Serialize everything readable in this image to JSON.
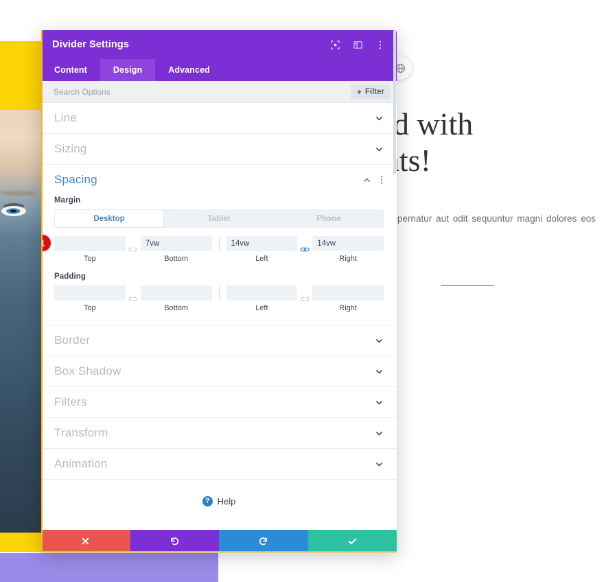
{
  "background": {
    "heading_line1": "worked with",
    "heading_line2": "g clients!",
    "paragraph": "tatem quia voluptas sit aspernatur aut odit sequuntur magni dolores eos qui ratione nt.",
    "globe_icon": "globe-icon"
  },
  "modal": {
    "title": "Divider Settings",
    "header_icons": [
      {
        "name": "focus-icon",
        "glyph": "⬚"
      },
      {
        "name": "panel-layout-icon",
        "glyph": "▣"
      },
      {
        "name": "more-options-icon",
        "glyph": "⋮"
      }
    ],
    "tabs": [
      {
        "label": "Content",
        "active": false
      },
      {
        "label": "Design",
        "active": true
      },
      {
        "label": "Advanced",
        "active": false
      }
    ],
    "search": {
      "placeholder": "Search Options",
      "value": ""
    },
    "filter": {
      "label": "Filter",
      "plus": "+"
    },
    "sections": [
      {
        "id": "line",
        "label": "Line",
        "open": false
      },
      {
        "id": "sizing",
        "label": "Sizing",
        "open": false
      },
      {
        "id": "spacing",
        "label": "Spacing",
        "open": true
      },
      {
        "id": "border",
        "label": "Border",
        "open": false
      },
      {
        "id": "box-shadow",
        "label": "Box Shadow",
        "open": false
      },
      {
        "id": "filters",
        "label": "Filters",
        "open": false
      },
      {
        "id": "transform",
        "label": "Transform",
        "open": false
      },
      {
        "id": "animation",
        "label": "Animation",
        "open": false
      }
    ],
    "spacing": {
      "badge": "1",
      "margin_label": "Margin",
      "padding_label": "Padding",
      "device_tabs": [
        {
          "label": "Desktop",
          "active": true
        },
        {
          "label": "Tablet",
          "active": false
        },
        {
          "label": "Phone",
          "active": false
        }
      ],
      "margin": {
        "top": {
          "caption": "Top",
          "value": ""
        },
        "bottom": {
          "caption": "Bottom",
          "value": "7vw"
        },
        "left": {
          "caption": "Left",
          "value": "14vw"
        },
        "right": {
          "caption": "Right",
          "value": "14vw"
        },
        "top_bottom_link": "unlinked",
        "left_right_link": "linked"
      },
      "padding": {
        "top": {
          "caption": "Top",
          "value": ""
        },
        "bottom": {
          "caption": "Bottom",
          "value": ""
        },
        "left": {
          "caption": "Left",
          "value": ""
        },
        "right": {
          "caption": "Right",
          "value": ""
        },
        "top_bottom_link": "unlinked",
        "left_right_link": "unlinked"
      }
    },
    "help": {
      "label": "Help",
      "icon_glyph": "?"
    },
    "actions": [
      {
        "name": "cancel-button",
        "glyph": "✖",
        "color": "#e8564e"
      },
      {
        "name": "undo-button",
        "glyph": "↺",
        "color": "#7b2fd4"
      },
      {
        "name": "redo-button",
        "glyph": "↻",
        "color": "#2b8bd6"
      },
      {
        "name": "save-button",
        "glyph": "✔",
        "color": "#2ec1a0"
      }
    ]
  },
  "colors": {
    "header_purple": "#7b2fd4",
    "tab_active_purple": "#8e45e0",
    "accent_blue": "#4c86b0",
    "badge_red": "#d70f17",
    "outline_yellow": "#f0b923",
    "page_yellow": "#fcd303",
    "page_purple": "#9b8ae8"
  }
}
